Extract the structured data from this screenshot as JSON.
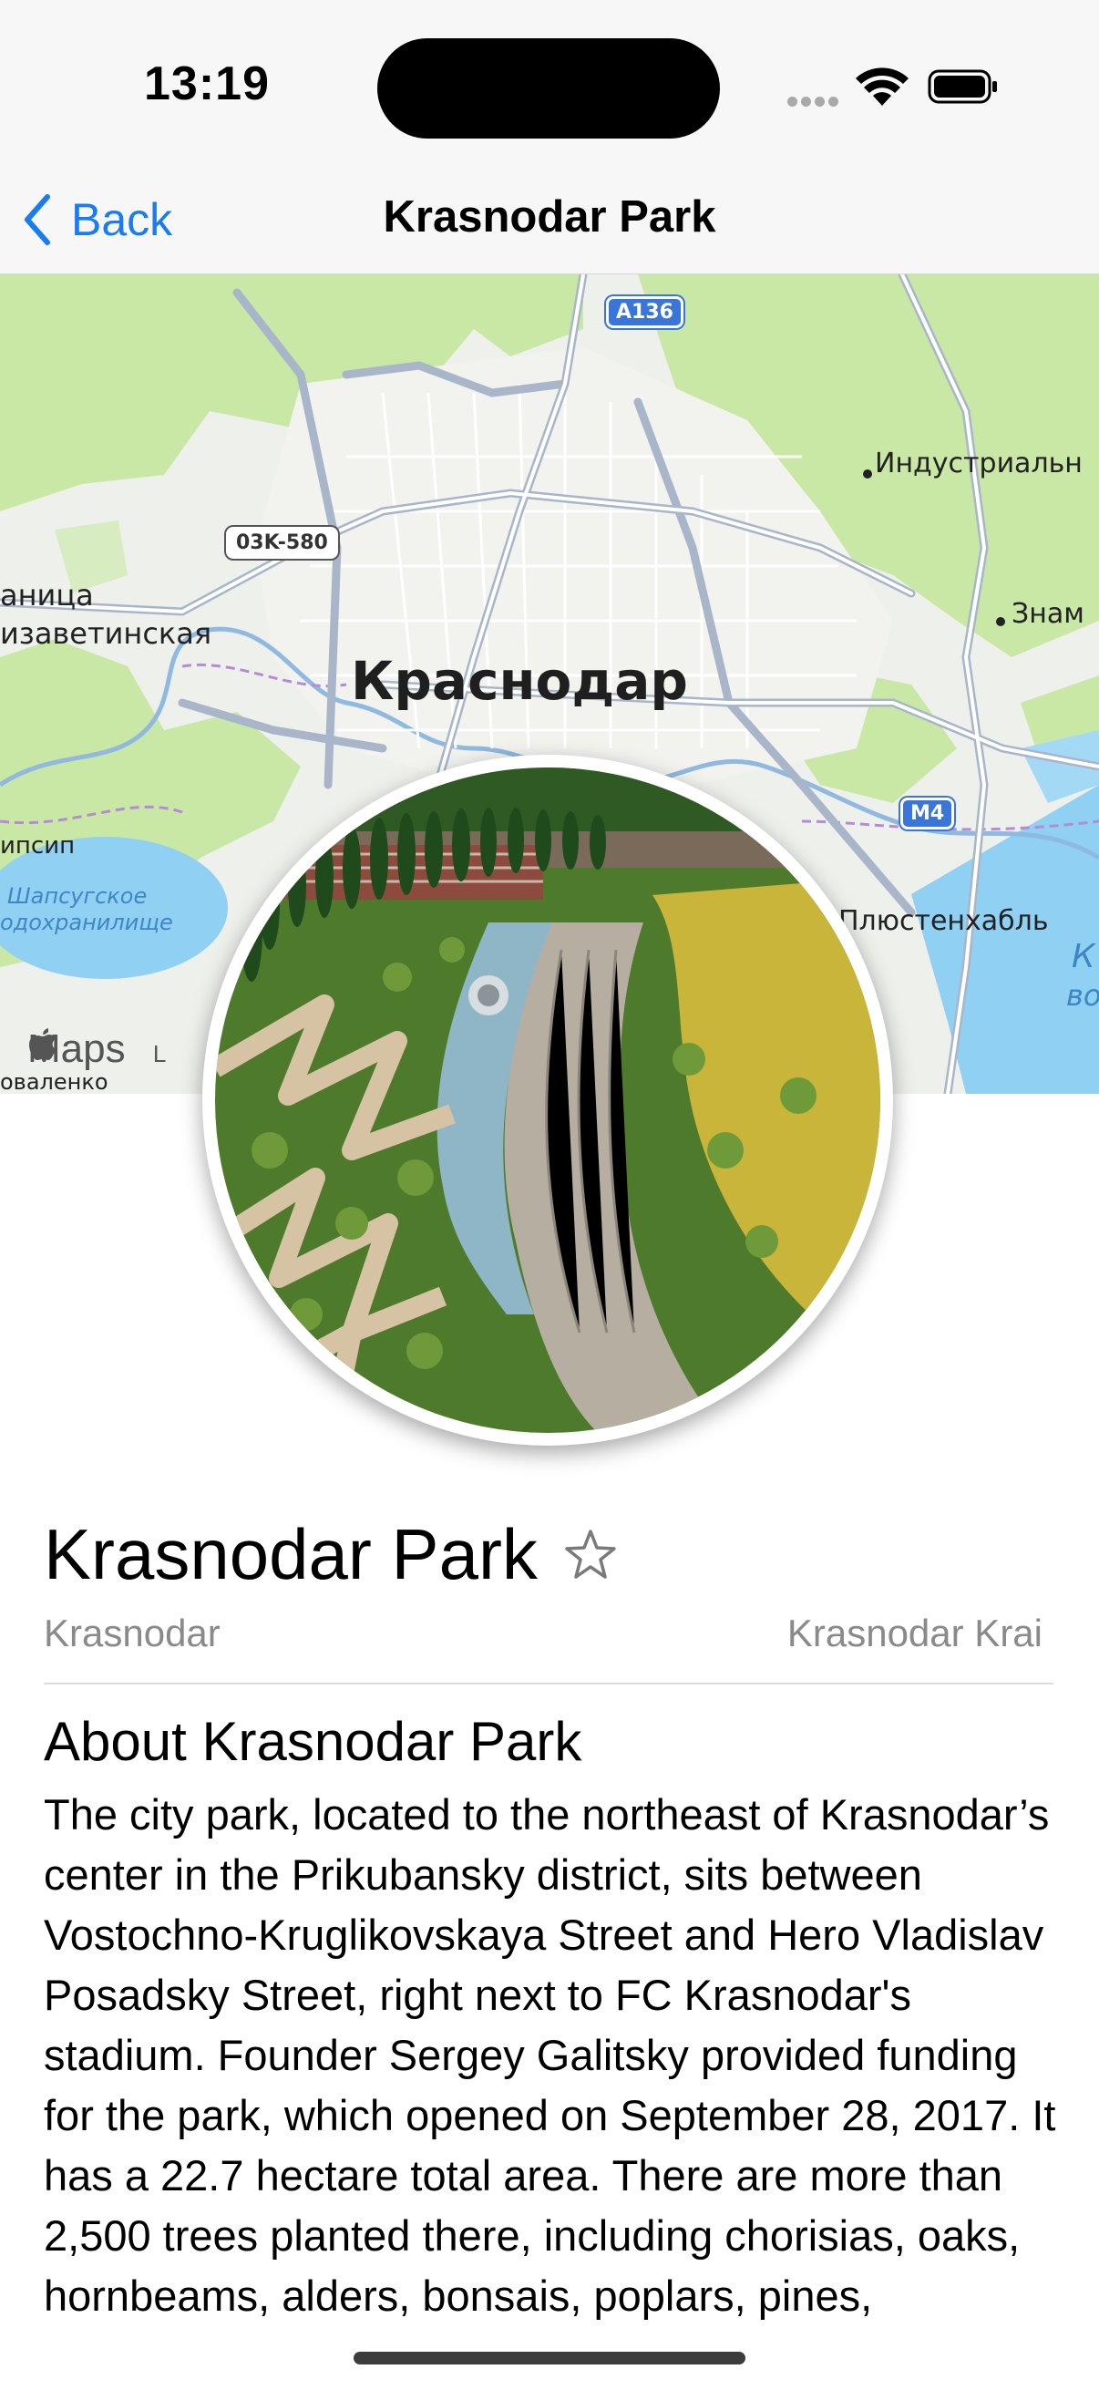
{
  "status_bar": {
    "time": "13:19"
  },
  "nav": {
    "back_label": "Back",
    "title": "Krasnodar Park"
  },
  "map": {
    "city_label": "Краснодар",
    "place_labels": {
      "industrial": "Индустриальн",
      "znam": "Знам",
      "stanitsa": "аница",
      "elizavetinskaya": "изаветинская",
      "ipsip": "ипсип",
      "plyustenkhabl": "Плюстенхабль",
      "kovalenko": "оваленко"
    },
    "water_labels": {
      "shapsug_1": "Шапсугское",
      "shapsug_2": "одохранилище",
      "k": "К",
      "vo": "во"
    },
    "road_badges": {
      "a136": "A136",
      "r03k": "03K-580",
      "m4": "M4"
    },
    "attribution": "Maps",
    "attribution_tail": "L"
  },
  "place": {
    "title": "Krasnodar Park",
    "city": "Krasnodar",
    "region": "Krasnodar Krai",
    "about_heading": "About Krasnodar Park",
    "about_text": "The city park, located to the northeast of Krasnodar’s center in the Prikubansky district, sits between Vostochno-Kruglikovskaya Street and Hero Vladislav Posadsky Street, right next to FC Krasnodar's stadium. Founder Sergey Galitsky provided funding for the park, which opened on September 28, 2017. It has a 22.7 hectare total area. There are more than 2,500 trees planted there, including chorisias, oaks, hornbeams, alders, bonsais, poplars, pines,"
  },
  "icons": {
    "back": "chevron-left-icon",
    "favorite": "star-outline-icon",
    "signal": "cellular-signal-icon",
    "wifi": "wifi-icon",
    "battery": "battery-icon",
    "apple": "apple-logo-icon"
  },
  "colors": {
    "accent": "#1a7cf5",
    "map_green": "#c9e8a6",
    "map_water": "#8fd0f3",
    "subtitle_gray": "#8a8a8a"
  }
}
